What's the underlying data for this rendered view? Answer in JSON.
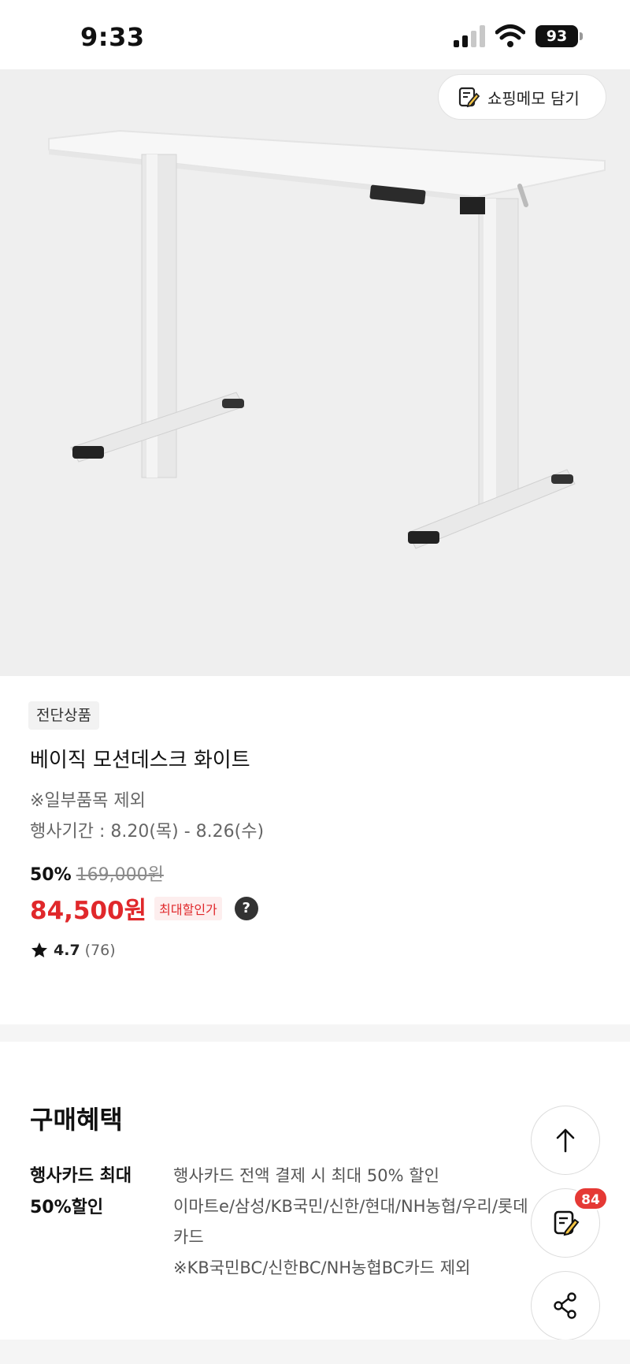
{
  "status_bar": {
    "time": "9:33",
    "battery": "93",
    "icons": [
      "signal-icon",
      "wifi-icon",
      "battery-icon"
    ]
  },
  "product_image": {
    "memo_button_label": "쇼핑메모 담기"
  },
  "product": {
    "badge": "전단상품",
    "title": "베이직 모션데스크 화이트",
    "note": "※일부품목 제외",
    "period": "행사기간 : 8.20(목) - 8.26(수)",
    "discount_rate": "50%",
    "original_price": "169,000원",
    "sale_price": "84,500원",
    "max_discount_label": "최대할인가",
    "help_symbol": "?",
    "rating": "4.7",
    "review_count": "(76)"
  },
  "benefits": {
    "heading": "구매혜택",
    "label_line1": "행사카드 최대",
    "label_line2": "50%할인",
    "desc_lines": [
      "행사카드 전액 결제 시 최대 50% 할인",
      "이마트e/삼성/KB국민/신한/현대/NH농협/우리/롯데",
      "카드",
      "※KB국민BC/신한BC/NH농협BC카드 제외"
    ]
  },
  "floating": {
    "memo_count": "84"
  },
  "colors": {
    "sale_red": "#e0282b",
    "badge_red": "#e53935",
    "image_bg": "#efefef"
  }
}
